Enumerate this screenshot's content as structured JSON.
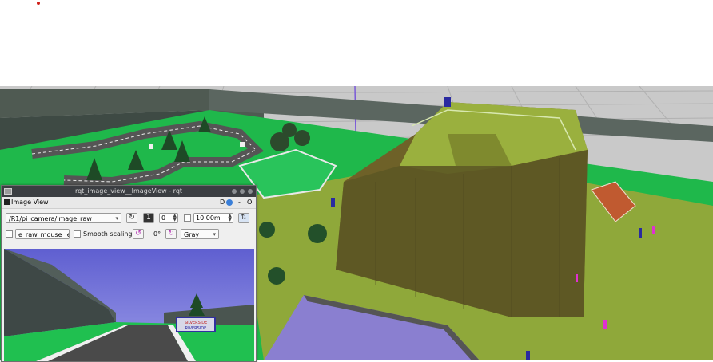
{
  "window": {
    "title": "rqt_image_view__ImageView - rqt"
  },
  "plugin": {
    "title": "Image View",
    "d_label": "D",
    "minimize_label": "-",
    "close_label": "O"
  },
  "toolbar": {
    "topic": "/R1/pi_camera/image_raw",
    "refresh_icon": "refresh-icon",
    "frame_value": "0",
    "max_range": "10.00m",
    "mouse_topic": "e_raw_mouse_left",
    "smooth_scaling_label": "Smooth scaling",
    "rotation": "0°",
    "color_scheme": "Gray"
  },
  "camera_sign": {
    "line1": "SILVERSIDE",
    "line2": "RIVERSIDE"
  },
  "colors": {
    "grass": "#20c050",
    "hill": "#6b7a2a",
    "sky": "#6e6ed8",
    "road": "#4a4a4a",
    "window_bg": "#efefef"
  }
}
